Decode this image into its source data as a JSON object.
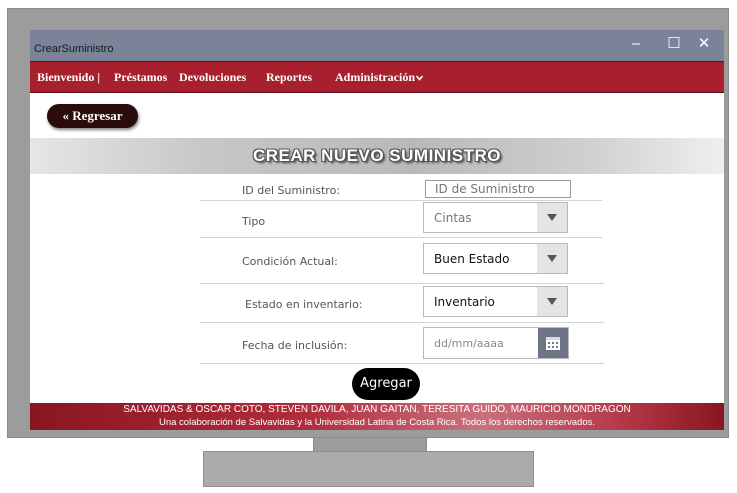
{
  "window": {
    "title": "CrearSuministro",
    "controls": {
      "minimize": "–",
      "maximize": "☐",
      "close": "✕"
    }
  },
  "nav": {
    "items": [
      {
        "label": "Bienvenido |"
      },
      {
        "label": "Préstamos"
      },
      {
        "label": "Devoluciones"
      },
      {
        "label": "Reportes"
      },
      {
        "label": "Administración"
      }
    ]
  },
  "back_button": "« Regresar",
  "banner_title": "CREAR NUEVO SUMINISTRO",
  "form": {
    "id_label": "ID del Suministro:",
    "id_placeholder": "ID de Suministro",
    "tipo_label": "Tipo",
    "tipo_value": "Cintas",
    "condicion_label": "Condición Actual:",
    "condicion_value": "Buen Estado",
    "estado_label": "Estado en inventario:",
    "estado_value": "Inventario",
    "fecha_label": "Fecha de inclusión:",
    "fecha_placeholder": "dd/mm/aaaa",
    "submit_label": "Agregar"
  },
  "footer": {
    "line1": "SALVAVIDAS & OSCAR COTO, STEVEN DAVILA, JUAN GAITAN, TERESITA GUIDO, MAURICIO MONDRAGON",
    "line2": "Una colaboración de Salvavidas y la Universidad Latina de Costa Rica. Todos los derechos reservados."
  },
  "colors": {
    "nav_background": "#a8202e",
    "titlebar": "#7a8398",
    "button_dark": "#2a0c0c",
    "footer": "#b02d3d"
  }
}
